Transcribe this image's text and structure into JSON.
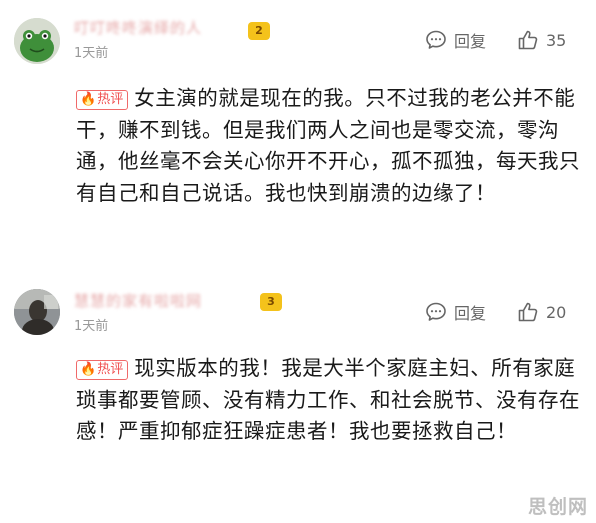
{
  "comments": [
    {
      "username": "叮叮咚咚演绎的人",
      "level": "2",
      "time": "1天前",
      "reply_label": "回复",
      "likes": "35",
      "tag": "热评",
      "text": "女主演的就是现在的我。只不过我的老公并不能干，赚不到钱。但是我们两人之间也是零交流，零沟通，他丝毫不会关心你开不开心，孤不孤独，每天我只有自己和自己说话。我也快到崩溃的边缘了！"
    },
    {
      "username": "慧慧的家有啦啦网",
      "level": "3",
      "time": "1天前",
      "reply_label": "回复",
      "likes": "20",
      "tag": "热评",
      "text": "现实版本的我！我是大半个家庭主妇、所有家庭琐事都要管顾、没有精力工作、和社会脱节、没有存在感！严重抑郁症狂躁症患者！我也要拯救自己！"
    }
  ],
  "watermark": "思创网",
  "colors": {
    "accent": "#f05050",
    "badge": "#f4c21b",
    "muted": "#999999"
  },
  "icons": {
    "reply": "comment-bubble-icon",
    "like": "thumbs-up-icon",
    "hot": "flame-icon"
  }
}
